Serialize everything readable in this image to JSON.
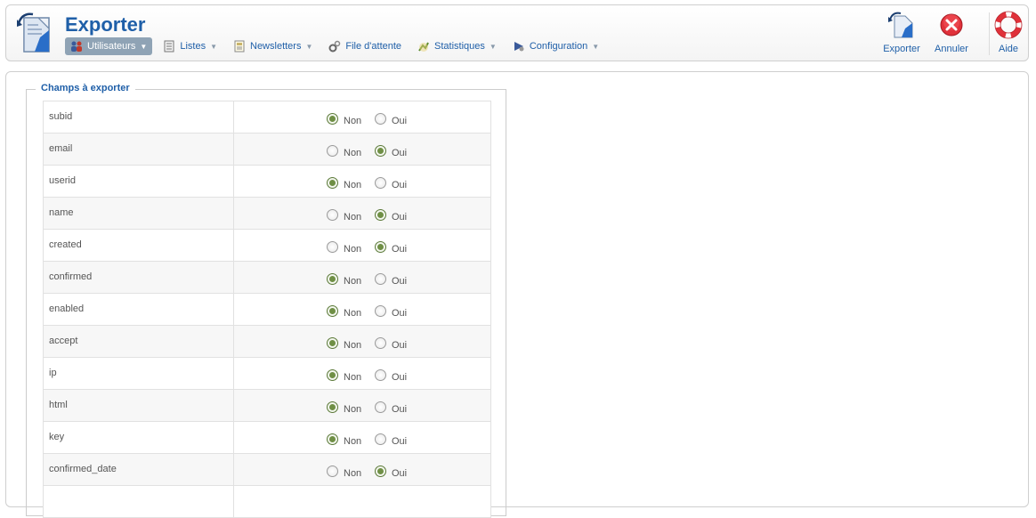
{
  "app": {
    "title": "Exporter"
  },
  "menu": [
    {
      "label": "Utilisateurs",
      "icon": "users-icon",
      "active": true,
      "caret": true
    },
    {
      "label": "Listes",
      "icon": "list-icon",
      "active": false,
      "caret": true
    },
    {
      "label": "Newsletters",
      "icon": "newsletter-icon",
      "active": false,
      "caret": true
    },
    {
      "label": "File d'attente",
      "icon": "queue-gear-icon",
      "active": false,
      "caret": false
    },
    {
      "label": "Statistiques",
      "icon": "stats-icon",
      "active": false,
      "caret": true
    },
    {
      "label": "Configuration",
      "icon": "config-icon",
      "active": false,
      "caret": true
    }
  ],
  "toolbar": {
    "export_label": "Exporter",
    "cancel_label": "Annuler",
    "help_label": "Aide"
  },
  "fieldset": {
    "legend": "Champs à exporter",
    "option_no": "Non",
    "option_yes": "Oui"
  },
  "fields": [
    {
      "name": "subid",
      "selected": "Non"
    },
    {
      "name": "email",
      "selected": "Oui"
    },
    {
      "name": "userid",
      "selected": "Non"
    },
    {
      "name": "name",
      "selected": "Oui"
    },
    {
      "name": "created",
      "selected": "Oui"
    },
    {
      "name": "confirmed",
      "selected": "Non"
    },
    {
      "name": "enabled",
      "selected": "Non"
    },
    {
      "name": "accept",
      "selected": "Non"
    },
    {
      "name": "ip",
      "selected": "Non"
    },
    {
      "name": "html",
      "selected": "Non"
    },
    {
      "name": "key",
      "selected": "Non"
    },
    {
      "name": "confirmed_date",
      "selected": "Oui"
    },
    {
      "name": "",
      "selected": ""
    }
  ],
  "colors": {
    "brand_blue": "#1f5fa8",
    "active_menu_bg": "#8fa3b5",
    "radio_checked": "#6f8f45",
    "cancel_red": "#e0313a"
  }
}
